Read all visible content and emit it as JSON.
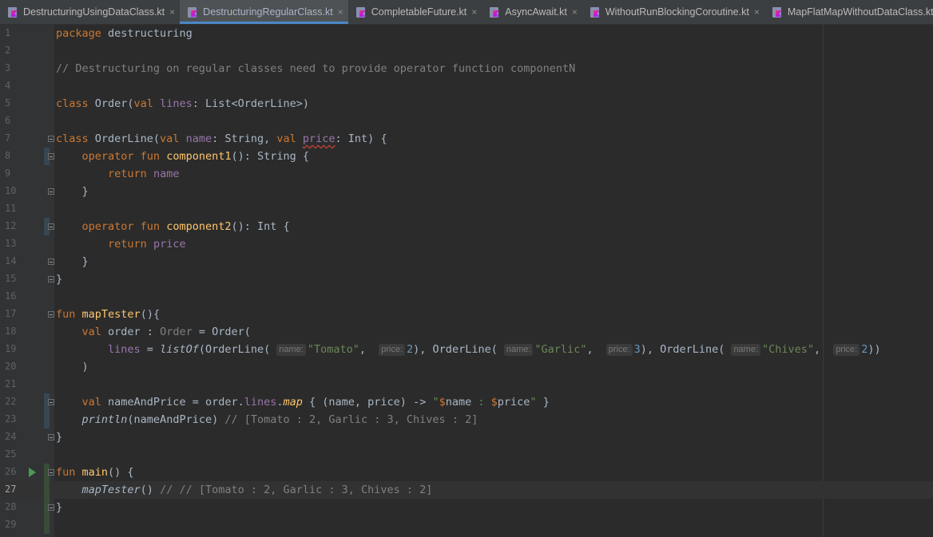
{
  "tabs": [
    {
      "label": "DestructuringUsingDataClass.kt",
      "active": false
    },
    {
      "label": "DestructuringRegularClass.kt",
      "active": true
    },
    {
      "label": "CompletableFuture.kt",
      "active": false
    },
    {
      "label": "AsyncAwait.kt",
      "active": false
    },
    {
      "label": "WithoutRunBlockingCoroutine.kt",
      "active": false
    },
    {
      "label": "MapFlatMapWithoutDataClass.kt",
      "active": false
    }
  ],
  "close_glyph": "×",
  "current_line": 27,
  "colors": {
    "keyword": "#cc7832",
    "comment": "#808080",
    "function": "#ffc66d",
    "property": "#9876aa",
    "string": "#6a8759",
    "number": "#6897bb"
  },
  "code": [
    {
      "n": "1",
      "t": [
        [
          "kw",
          "package"
        ],
        [
          "p",
          " destructuring"
        ]
      ]
    },
    {
      "n": "2",
      "t": []
    },
    {
      "n": "3",
      "t": [
        [
          "cm",
          "// Destructuring on regular classes need to provide operator function componentN"
        ]
      ]
    },
    {
      "n": "4",
      "t": []
    },
    {
      "n": "5",
      "t": [
        [
          "kw",
          "class"
        ],
        [
          "p",
          " Order("
        ],
        [
          "kw",
          "val"
        ],
        [
          "p",
          " "
        ],
        [
          "prop",
          "lines"
        ],
        [
          "p",
          ": List<OrderLine>)"
        ]
      ]
    },
    {
      "n": "6",
      "t": []
    },
    {
      "n": "7",
      "t": [
        [
          "kw",
          "class"
        ],
        [
          "p",
          " OrderLine("
        ],
        [
          "kw",
          "val"
        ],
        [
          "p",
          " "
        ],
        [
          "prop",
          "name"
        ],
        [
          "p",
          ": String, "
        ],
        [
          "kw",
          "val"
        ],
        [
          "p",
          " "
        ],
        [
          "propsq",
          "price"
        ],
        [
          "p",
          ": Int) {"
        ]
      ]
    },
    {
      "n": "8",
      "t": [
        [
          "p",
          "    "
        ],
        [
          "kw",
          "operator fun"
        ],
        [
          "p",
          " "
        ],
        [
          "fn",
          "component1"
        ],
        [
          "p",
          "(): String {"
        ]
      ]
    },
    {
      "n": "9",
      "t": [
        [
          "p",
          "        "
        ],
        [
          "kw",
          "return"
        ],
        [
          "p",
          " "
        ],
        [
          "prop",
          "name"
        ]
      ]
    },
    {
      "n": "10",
      "t": [
        [
          "p",
          "    }"
        ]
      ]
    },
    {
      "n": "11",
      "t": []
    },
    {
      "n": "12",
      "t": [
        [
          "p",
          "    "
        ],
        [
          "kw",
          "operator fun"
        ],
        [
          "p",
          " "
        ],
        [
          "fn",
          "component2"
        ],
        [
          "p",
          "(): Int {"
        ]
      ]
    },
    {
      "n": "13",
      "t": [
        [
          "p",
          "        "
        ],
        [
          "kw",
          "return"
        ],
        [
          "p",
          " "
        ],
        [
          "prop",
          "price"
        ]
      ]
    },
    {
      "n": "14",
      "t": [
        [
          "p",
          "    }"
        ]
      ]
    },
    {
      "n": "15",
      "t": [
        [
          "p",
          "}"
        ]
      ]
    },
    {
      "n": "16",
      "t": []
    },
    {
      "n": "17",
      "t": [
        [
          "kw",
          "fun"
        ],
        [
          "p",
          " "
        ],
        [
          "fn",
          "mapTester"
        ],
        [
          "p",
          "(){"
        ]
      ]
    },
    {
      "n": "18",
      "t": [
        [
          "p",
          "    "
        ],
        [
          "kw",
          "val"
        ],
        [
          "p",
          " order : "
        ],
        [
          "cm",
          "Order"
        ],
        [
          "p",
          " = Order("
        ]
      ]
    },
    {
      "n": "19",
      "t": [
        [
          "p",
          "        "
        ],
        [
          "prop",
          "lines"
        ],
        [
          "p",
          " = "
        ],
        [
          "it",
          "listOf"
        ],
        [
          "p",
          "(OrderLine("
        ],
        [
          "hint",
          "name:"
        ],
        [
          "str",
          "\"Tomato\""
        ],
        [
          "p",
          ", "
        ],
        [
          "hint",
          "price:"
        ],
        [
          "num",
          "2"
        ],
        [
          "p",
          "), OrderLine("
        ],
        [
          "hint",
          "name:"
        ],
        [
          "str",
          "\"Garlic\""
        ],
        [
          "p",
          ", "
        ],
        [
          "hint",
          "price:"
        ],
        [
          "num",
          "3"
        ],
        [
          "p",
          "), OrderLine("
        ],
        [
          "hint",
          "name:"
        ],
        [
          "str",
          "\"Chives\""
        ],
        [
          "p",
          ", "
        ],
        [
          "hint",
          "price:"
        ],
        [
          "num",
          "2"
        ],
        [
          "p",
          "))"
        ]
      ]
    },
    {
      "n": "20",
      "t": [
        [
          "p",
          "    )"
        ]
      ]
    },
    {
      "n": "21",
      "t": []
    },
    {
      "n": "22",
      "t": [
        [
          "p",
          "    "
        ],
        [
          "kw",
          "val"
        ],
        [
          "p",
          " nameAndPrice = order."
        ],
        [
          "prop",
          "lines"
        ],
        [
          "p",
          "."
        ],
        [
          "it2",
          "map"
        ],
        [
          "p",
          " { (name, price) -> "
        ],
        [
          "str",
          "\""
        ],
        [
          "tmpl",
          "$"
        ],
        [
          "p",
          "name"
        ],
        [
          "str",
          " : "
        ],
        [
          "tmpl",
          "$"
        ],
        [
          "p",
          "price"
        ],
        [
          "str",
          "\""
        ],
        [
          "p",
          " }"
        ]
      ]
    },
    {
      "n": "23",
      "t": [
        [
          "p",
          "    "
        ],
        [
          "it",
          "println"
        ],
        [
          "p",
          "(nameAndPrice) "
        ],
        [
          "cm",
          "// [Tomato : 2, Garlic : 3, Chives : 2]"
        ]
      ]
    },
    {
      "n": "24",
      "t": [
        [
          "p",
          "}"
        ]
      ]
    },
    {
      "n": "25",
      "t": []
    },
    {
      "n": "26",
      "t": [
        [
          "kw",
          "fun"
        ],
        [
          "p",
          " "
        ],
        [
          "fn",
          "main"
        ],
        [
          "p",
          "() {"
        ]
      ]
    },
    {
      "n": "27",
      "t": [
        [
          "p",
          "    "
        ],
        [
          "it",
          "mapTester"
        ],
        [
          "p",
          "() "
        ],
        [
          "cm",
          "// // [Tomato : 2, Garlic : 3, Chives : 2]"
        ]
      ]
    },
    {
      "n": "28",
      "t": [
        [
          "p",
          "}"
        ]
      ]
    },
    {
      "n": "29",
      "t": []
    }
  ]
}
